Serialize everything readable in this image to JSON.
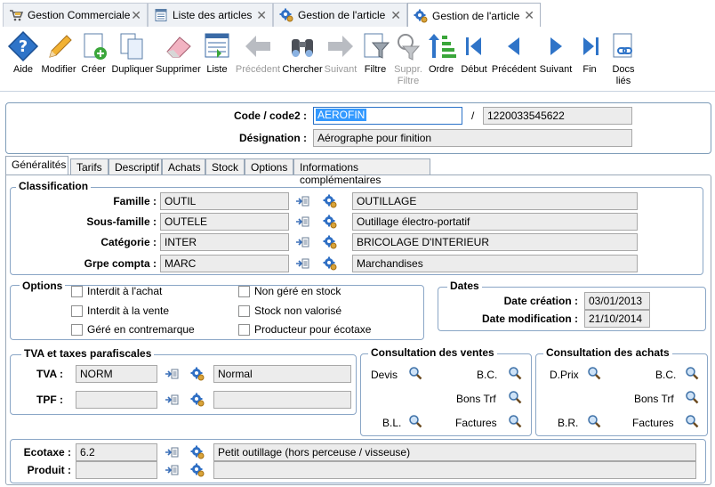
{
  "tabs": [
    {
      "label": "Gestion Commerciale"
    },
    {
      "label": "Liste des articles"
    },
    {
      "label": "Gestion de l'article"
    },
    {
      "label": "Gestion de l'article"
    }
  ],
  "toolbar": {
    "aide": "Aide",
    "modifier": "Modifier",
    "creer": "Créer",
    "dupliquer": "Dupliquer",
    "supprimer": "Supprimer",
    "liste": "Liste",
    "precedent1": "Précédent",
    "chercher": "Chercher",
    "suivant1": "Suivant",
    "filtre": "Filtre",
    "suppr_filtre_1": "Suppr.",
    "suppr_filtre_2": "Filtre",
    "ordre": "Ordre",
    "debut": "Début",
    "precedent2": "Précédent",
    "suivant2": "Suivant",
    "fin": "Fin",
    "docs_1": "Docs",
    "docs_2": "liés"
  },
  "header": {
    "code_label": "Code / code2 :",
    "code_value": "AEROFIN",
    "separator": "/",
    "code2_value": "1220033545622",
    "designation_label": "Désignation :",
    "designation_value": "Aérographe pour finition"
  },
  "page_tabs": [
    "Généralités",
    "Tarifs",
    "Descriptif",
    "Achats",
    "Stock",
    "Options",
    "Informations complémentaires"
  ],
  "classification": {
    "legend": "Classification",
    "rows": [
      {
        "label": "Famille :",
        "code": "OUTIL",
        "desc": "OUTILLAGE"
      },
      {
        "label": "Sous-famille :",
        "code": "OUTELE",
        "desc": "Outillage électro-portatif"
      },
      {
        "label": "Catégorie :",
        "code": "INTER",
        "desc": "BRICOLAGE D'INTERIEUR"
      },
      {
        "label": "Grpe compta :",
        "code": "MARC",
        "desc": "Marchandises"
      }
    ]
  },
  "options": {
    "legend": "Options",
    "items": [
      "Interdit à l'achat",
      "Interdit à la vente",
      "Géré en contremarque",
      "Non géré en stock",
      "Stock non valorisé",
      "Producteur pour écotaxe"
    ]
  },
  "dates": {
    "legend": "Dates",
    "creation_label": "Date création :",
    "creation_value": "03/01/2013",
    "modif_label": "Date modification :",
    "modif_value": "21/10/2014"
  },
  "tva": {
    "legend": "TVA et taxes parafiscales",
    "tva_label": "TVA :",
    "tva_code": "NORM",
    "tva_desc": "Normal",
    "tpf_label": "TPF :",
    "tpf_code": "",
    "tpf_desc": ""
  },
  "ventes": {
    "legend": "Consultation des ventes",
    "devis": "Devis",
    "bc": "B.C.",
    "bons_trf": "Bons Trf",
    "bl": "B.L.",
    "factures": "Factures"
  },
  "achats": {
    "legend": "Consultation des achats",
    "dprix": "D.Prix",
    "bc": "B.C.",
    "bons_trf": "Bons Trf",
    "br": "B.R.",
    "factures": "Factures"
  },
  "ecotaxe": {
    "ecotaxe_label": "Ecotaxe :",
    "ecotaxe_code": "6.2",
    "ecotaxe_desc": "Petit outillage (hors perceuse / visseuse)",
    "produit_label": "Produit :",
    "produit_code": "",
    "produit_desc": ""
  },
  "colors": {
    "selection": "#3399ff",
    "border": "#7f9db9",
    "field_bg": "#ececec",
    "accent": "#2a6fc9"
  }
}
